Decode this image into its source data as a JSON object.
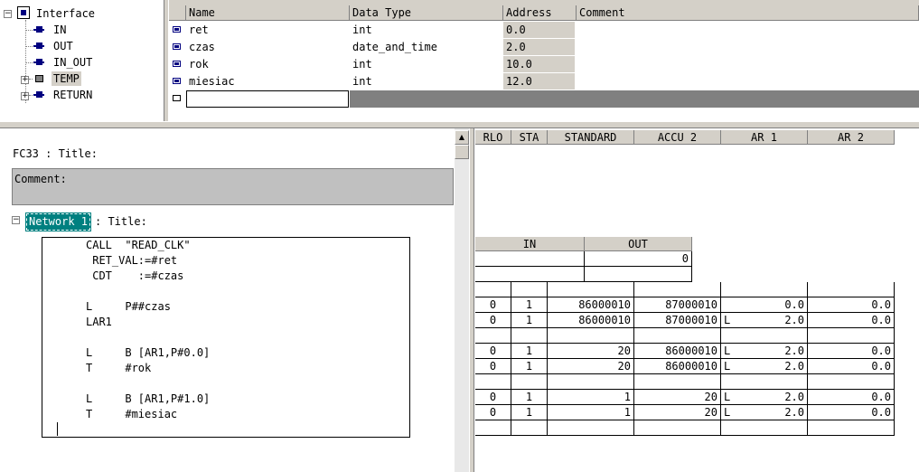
{
  "tree": {
    "root": "Interface",
    "items": [
      {
        "label": "IN",
        "expandable": false
      },
      {
        "label": "OUT",
        "expandable": false
      },
      {
        "label": "IN_OUT",
        "expandable": false
      },
      {
        "label": "TEMP",
        "expandable": true
      },
      {
        "label": "RETURN",
        "expandable": true
      }
    ]
  },
  "decl": {
    "headers": {
      "name": "Name",
      "type": "Data Type",
      "address": "Address",
      "comment": "Comment"
    },
    "rows": [
      {
        "name": "ret",
        "type": "int",
        "address": "0.0"
      },
      {
        "name": "czas",
        "type": "date_and_time",
        "address": "2.0"
      },
      {
        "name": "rok",
        "type": "int",
        "address": "10.0"
      },
      {
        "name": "miesiac",
        "type": "int",
        "address": "12.0"
      }
    ]
  },
  "editor": {
    "block_title": "FC33 : Title:",
    "comment_label": "Comment:",
    "network_label": "Network 1",
    "network_title": ": Title:",
    "code_lines": [
      "CALL  \"READ_CLK\"",
      " RET_VAL:=#ret",
      " CDT    :=#czas",
      "",
      "L     P##czas",
      "LAR1",
      "",
      "L     B [AR1,P#0.0]",
      "T     #rok",
      "",
      "L     B [AR1,P#1.0]",
      "T     #miesiac"
    ]
  },
  "status": {
    "headers": {
      "rlo": "RLO",
      "sta": "STA",
      "standard": "STANDARD",
      "accu2": "ACCU 2",
      "ar1": "AR 1",
      "ar2": "AR 2"
    },
    "in_label": "IN",
    "out_label": "OUT",
    "out_value": "0",
    "rows": [
      [
        "0",
        "1",
        "86000010",
        "87000010",
        "",
        "0.0",
        "0.0"
      ],
      [
        "0",
        "1",
        "86000010",
        "87000010",
        "L",
        "2.0",
        "0.0"
      ],
      [
        "",
        "",
        "",
        "",
        "",
        "",
        ""
      ],
      [
        "0",
        "1",
        "20",
        "86000010",
        "L",
        "2.0",
        "0.0"
      ],
      [
        "0",
        "1",
        "20",
        "86000010",
        "L",
        "2.0",
        "0.0"
      ],
      [
        "",
        "",
        "",
        "",
        "",
        "",
        ""
      ],
      [
        "0",
        "1",
        "1",
        "20",
        "L",
        "2.0",
        "0.0"
      ],
      [
        "0",
        "1",
        "1",
        "20",
        "L",
        "2.0",
        "0.0"
      ],
      [
        "",
        "",
        "",
        "",
        "",
        "",
        ""
      ]
    ]
  },
  "colors": {
    "addr_bg": "#d4d0c8",
    "comment_bg": "#c0c0c0",
    "network_label_bg": "#008080",
    "empty_row_bg": "#808080"
  }
}
